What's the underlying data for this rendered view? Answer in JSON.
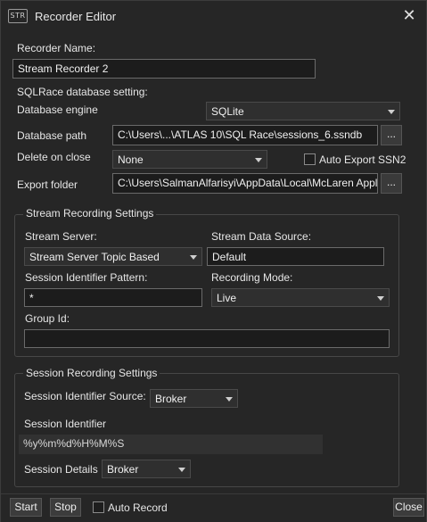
{
  "window": {
    "icon_text": "STR",
    "title": "Recorder Editor"
  },
  "recorder_name": {
    "label": "Recorder Name:",
    "value": "Stream Recorder 2"
  },
  "sqlrace": {
    "section_label": "SQLRace database setting:",
    "engine_label": "Database engine",
    "engine_value": "SQLite",
    "path_label": "Database path",
    "path_value": "C:\\Users\\...\\ATLAS 10\\SQL Race\\sessions_6.ssndb",
    "browse_label": "...",
    "delete_label": "Delete on close",
    "delete_value": "None",
    "auto_export_label": "Auto Export SSN2",
    "export_label": "Export folder",
    "export_value": "C:\\Users\\SalmanAlfarisyi\\AppData\\Local\\McLaren Appl"
  },
  "stream": {
    "group_title": "Stream Recording Settings",
    "server_label": "Stream Server:",
    "server_value": "Stream Server Topic Based",
    "source_label": "Stream Data Source:",
    "source_value": "Default",
    "pattern_label": "Session Identifier Pattern:",
    "pattern_value": "*",
    "mode_label": "Recording Mode:",
    "mode_value": "Live",
    "group_id_label": "Group Id:",
    "group_id_value": ""
  },
  "session": {
    "group_title": "Session Recording Settings",
    "source_label": "Session Identifier Source:",
    "source_value": "Broker",
    "identifier_label": "Session Identifier",
    "identifier_value": "%y%m%d%H%M%S",
    "details_label": "Session Details",
    "details_value": "Broker"
  },
  "footer": {
    "start_label": "Start",
    "stop_label": "Stop",
    "auto_record_label": "Auto Record",
    "close_label": "Close"
  }
}
